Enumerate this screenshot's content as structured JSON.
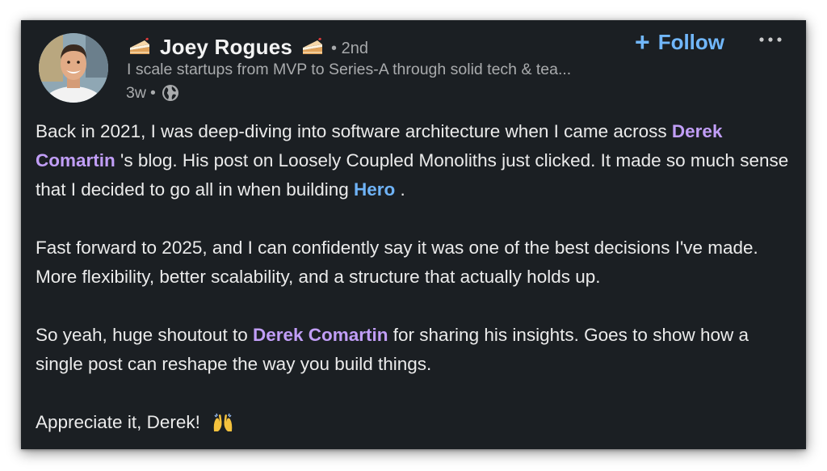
{
  "author": {
    "name": "Joey Rogues",
    "name_prefix_icon": "cake-icon",
    "name_suffix_icon": "cake-icon",
    "degree": "• 2nd",
    "headline": "I scale startups from MVP to Series-A through solid tech & tea...",
    "time": "3w",
    "separator": "•",
    "visibility_icon": "globe-icon"
  },
  "actions": {
    "follow_icon": "plus-icon",
    "follow_label": "Follow",
    "more_icon": "more-options-icon"
  },
  "post": {
    "p1": {
      "t1": "Back in 2021, I was deep-diving into software architecture when I came across ",
      "mention1": "Derek Comartin",
      "t2": " 's blog. His post on Loosely Coupled Monoliths just clicked. It made so much sense that I decided to go all in when building ",
      "company": "Hero",
      "t3": " ."
    },
    "p2": "Fast forward to 2025, and I can confidently say it was one of the best decisions I've made. More flexibility, better scalability, and a structure that actually holds up.",
    "p3": {
      "t1": "So yeah, huge shoutout to ",
      "mention": "Derek Comartin",
      "t2": " for sharing his insights. Goes to show how a single post can reshape the way you build things."
    },
    "p4": {
      "text": "Appreciate it, Derek! ",
      "emoji": "raising-hands-icon"
    }
  },
  "colors": {
    "card_background": "#1b1f23",
    "follow_blue": "#71b7fb",
    "mention_purple": "#c19ef7",
    "company_blue": "#6fb3f7",
    "muted_text": "#a9abad"
  }
}
